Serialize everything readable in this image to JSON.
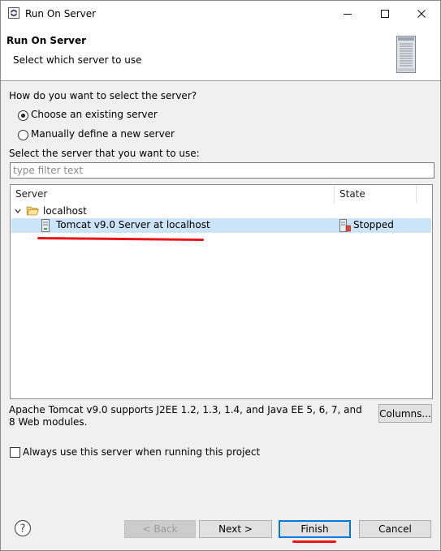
{
  "window": {
    "title": "Run On Server"
  },
  "window_controls": {
    "minimize": "—",
    "maximize": "☐",
    "close": "✕"
  },
  "header": {
    "title": "Run On Server",
    "description": "Select which server to use"
  },
  "selection": {
    "question": "How do you want to select the server?",
    "option_existing": "Choose an existing server",
    "option_manual": "Manually define a new server",
    "selected": "existing"
  },
  "server_list": {
    "label": "Select the server that you want to use:",
    "filter_placeholder": "type filter text",
    "filter_value": "",
    "columns": {
      "server": "Server",
      "state": "State"
    },
    "group": {
      "name": "localhost",
      "expanded": true
    },
    "rows": [
      {
        "name": "Tomcat v9.0 Server at localhost",
        "state": "Stopped",
        "selected": true
      }
    ]
  },
  "description": "Apache Tomcat v9.0 supports J2EE 1.2, 1.3, 1.4, and Java EE 5, 6, 7, and 8 Web modules.",
  "columns_button": "Columns...",
  "always_use": {
    "label": "Always use this server when running this project",
    "checked": false
  },
  "footer": {
    "help_icon": "help-icon",
    "back": "< Back",
    "next": "Next >",
    "finish": "Finish",
    "cancel": "Cancel"
  },
  "colors": {
    "selection": "#cce4f7",
    "annotation": "#e8161b",
    "focus": "#0078d7"
  }
}
